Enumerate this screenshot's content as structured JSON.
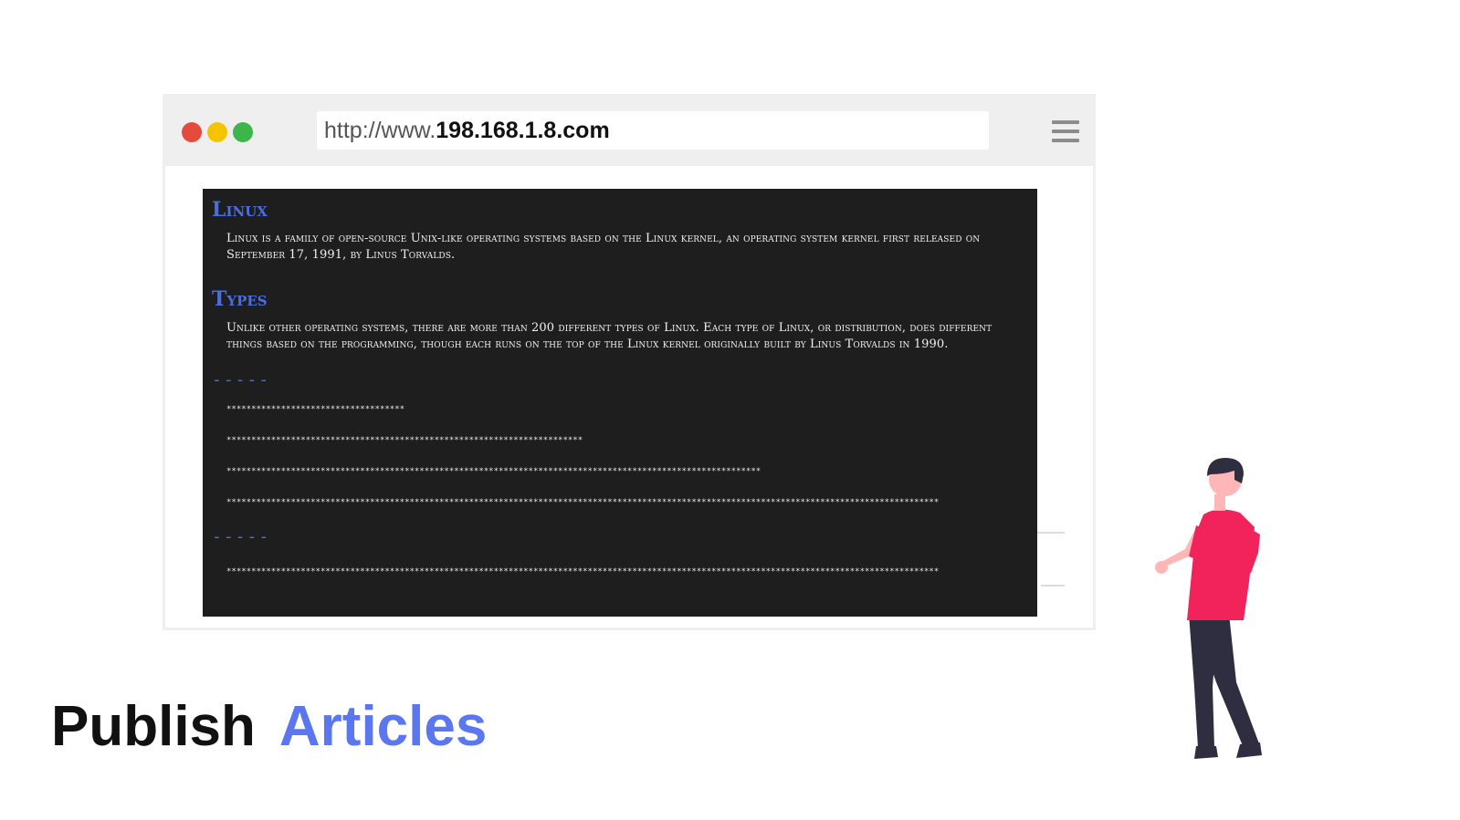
{
  "browser": {
    "address_prefix": "http://www.",
    "address_host": "198.168.1.8.com"
  },
  "article": {
    "heading1": "Linux",
    "paragraph1": "Linux is a family of open-source Unix-like operating systems based on the Linux kernel, an operating system kernel first released on September 17, 1991, by Linus Torvalds.",
    "heading2": "Types",
    "paragraph2": "Unlike other operating systems, there are more than 200 different types of Linux. Each type of Linux, or distribution, does different things based on the programming, though each runs on the top of the Linux kernel originally built by Linus Torvalds in 1990.",
    "divider1": "-----",
    "stars1": "************************************",
    "stars2": "************************************************************************",
    "stars3": "************************************************************************************************************",
    "stars4": "************************************************************************************************************************************************",
    "divider2": "-----",
    "stars5": "************************************************************************************************************************************************"
  },
  "caption": {
    "word1": "Publish",
    "word2": "Articles"
  },
  "colors": {
    "accent": "#5b77f0",
    "panel": "#1e1e1e",
    "shirt": "#f2235a",
    "pants": "#2f2e41"
  }
}
